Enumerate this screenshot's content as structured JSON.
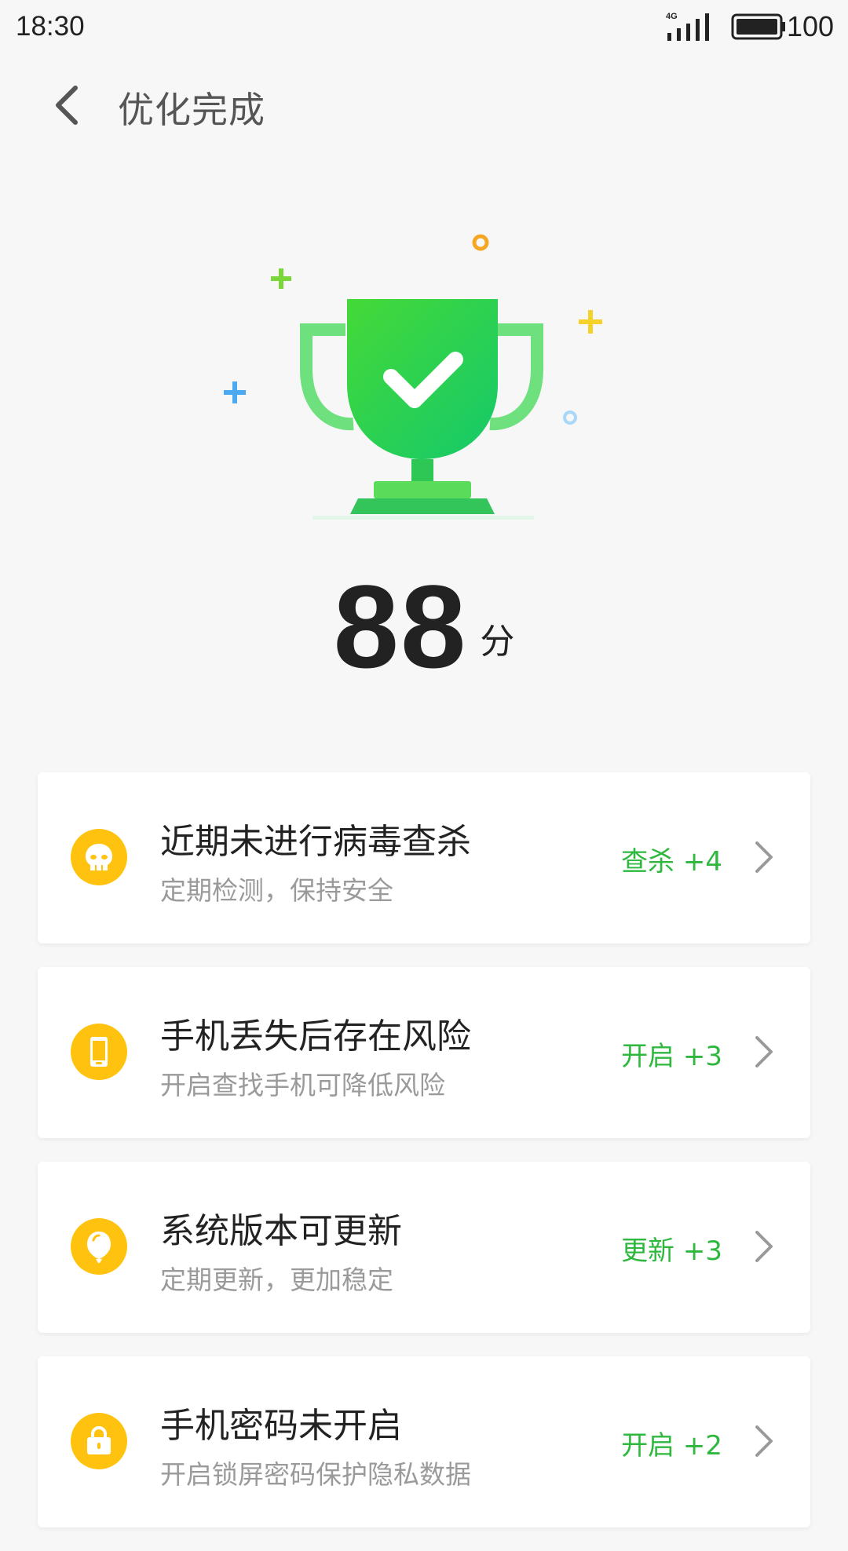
{
  "status_bar": {
    "time": "18:30",
    "network": "4G",
    "battery": "100"
  },
  "header": {
    "title": "优化完成"
  },
  "score": {
    "value": "88",
    "unit": "分"
  },
  "colors": {
    "accent_green": "#2EB83E",
    "trophy_green": "#33CC55",
    "warning_yellow": "#FFC20E"
  },
  "items": [
    {
      "icon": "skull-icon",
      "title": "近期未进行病毒查杀",
      "subtitle": "定期检测，保持安全",
      "action": "查杀 +4"
    },
    {
      "icon": "phone-icon",
      "title": "手机丢失后存在风险",
      "subtitle": "开启查找手机可降低风险",
      "action": "开启 +3"
    },
    {
      "icon": "balloon-icon",
      "title": "系统版本可更新",
      "subtitle": "定期更新，更加稳定",
      "action": "更新 +3"
    },
    {
      "icon": "lock-icon",
      "title": "手机密码未开启",
      "subtitle": "开启锁屏密码保护隐私数据",
      "action": "开启 +2"
    }
  ]
}
